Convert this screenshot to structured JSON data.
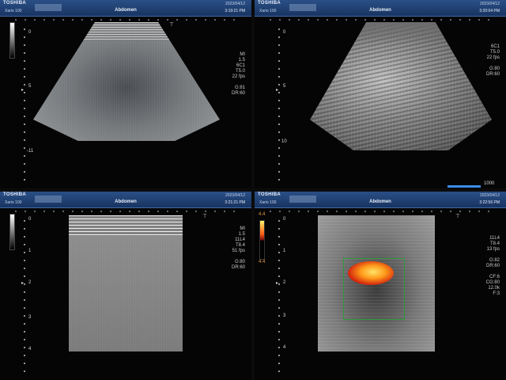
{
  "quadrants": [
    {
      "brand": "TOSHIBA",
      "model": "Xario 100",
      "exam": "Abdomen",
      "date": "2023/04/12",
      "time": "3:19:21 PM",
      "params": [
        "MI",
        "1.5",
        "6C1",
        "T5.0",
        "22 fps",
        "",
        "G:81",
        "DR:60"
      ],
      "depth": [
        "0",
        "5",
        "-11"
      ]
    },
    {
      "brand": "TOSHIBA",
      "model": "Xario 100",
      "exam": "Abdomen",
      "date": "2023/04/12",
      "time": "3:20:04 PM",
      "params": [
        "6C1",
        "T5.0",
        "22 fps",
        "",
        "G:80",
        "DR:60"
      ],
      "depth": [
        "0",
        "5",
        "10"
      ],
      "scale_label": "1000"
    },
    {
      "brand": "TOSHIBA",
      "model": "Xario 100",
      "exam": "Abdomen",
      "date": "2023/04/12",
      "time": "3:21:21 PM",
      "params": [
        "MI",
        "1.5",
        "11L4",
        "T8.4",
        "51 fps",
        "",
        "G:80",
        "DR:60"
      ],
      "depth": [
        "0",
        "1",
        "2",
        "3",
        "4"
      ]
    },
    {
      "brand": "TOSHIBA",
      "model": "Xario 100",
      "exam": "Abdomen",
      "date": "2023/04/12",
      "time": "3:22:56 PM",
      "params": [
        "11L4",
        "T8.4",
        "13 fps",
        "",
        "G:82",
        "DR:60",
        "",
        "CF:6",
        "CG:80",
        "12.0k",
        "F:3"
      ],
      "depth": [
        "0",
        "1",
        "2",
        "3",
        "4"
      ],
      "cf_scale": [
        "4.4",
        "4.4"
      ]
    }
  ],
  "colors": {
    "header": "#1f3f73",
    "flow_hot": "#ff9a1a",
    "roi": "#2f9a3a",
    "scale": "#3c8ce8"
  }
}
